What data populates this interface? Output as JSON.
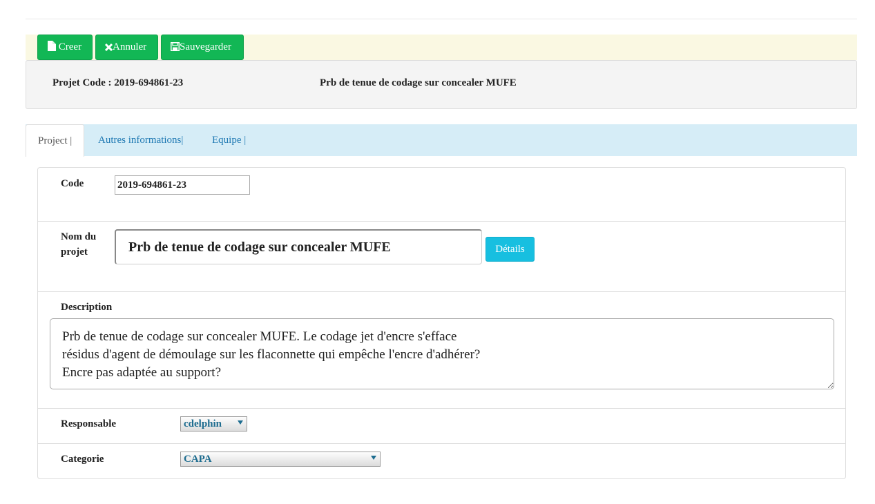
{
  "toolbar": {
    "creer_label": "Creer",
    "annuler_label": "Annuler",
    "sauvegarder_label": "Sauvegarder"
  },
  "header": {
    "code_text": "Projet Code : 2019-694861-23",
    "project_title": "Prb de tenue de codage sur concealer MUFE"
  },
  "tabs": [
    {
      "label": "Project |"
    },
    {
      "label": "Autres informations|"
    },
    {
      "label": "Equipe |"
    }
  ],
  "form": {
    "code_label": "Code",
    "code_value": "2019-694861-23",
    "nom_label_line1": "Nom du",
    "nom_label_line2": "projet",
    "nom_value": "Prb de tenue de codage sur concealer MUFE",
    "details_label": "Détails",
    "description_label": "Description",
    "description_value": "Prb de tenue de codage sur concealer MUFE. Le codage jet d'encre s'efface\nrésidus d'agent de démoulage sur les flaconnette qui empêche l'encre d'adhérer?\nEncre pas adaptée au support?",
    "responsable_label": "Responsable",
    "responsable_value": "cdelphin",
    "categorie_label": "Categorie",
    "categorie_value": "CAPA"
  },
  "colors": {
    "toolbar_bg": "#faf8e2",
    "button_green": "#12b755",
    "tab_bar_bg": "#d6edf7",
    "details_button": "#17bfe0",
    "select_text": "#1d6c8f"
  },
  "icons": {
    "creer": "file-icon",
    "annuler": "close-icon",
    "sauvegarder": "save-icon"
  }
}
